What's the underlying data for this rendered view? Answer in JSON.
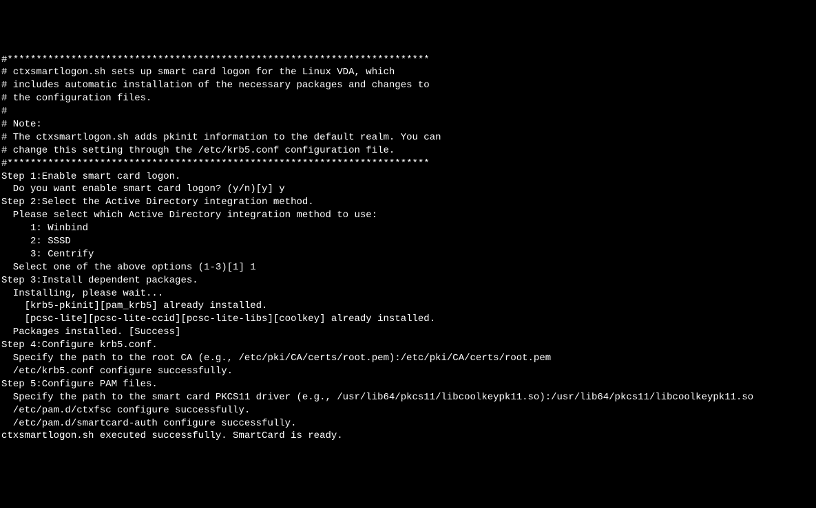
{
  "lines": {
    "l00": "#*************************************************************************",
    "l01": "# ctxsmartlogon.sh sets up smart card logon for the Linux VDA, which",
    "l02": "# includes automatic installation of the necessary packages and changes to",
    "l03": "# the configuration files.",
    "l04": "#",
    "l05": "# Note:",
    "l06": "# The ctxsmartlogon.sh adds pkinit information to the default realm. You can",
    "l07": "# change this setting through the /etc/krb5.conf configuration file.",
    "l08": "#*************************************************************************",
    "l09": "Step 1:Enable smart card logon.",
    "l10": "  Do you want enable smart card logon? (y/n)[y] y",
    "l11": "Step 2:Select the Active Directory integration method.",
    "l12": "  Please select which Active Directory integration method to use:",
    "l13": "     1: Winbind",
    "l14": "     2: SSSD",
    "l15": "     3: Centrify",
    "l16": "  Select one of the above options (1-3)[1] 1",
    "l17": "Step 3:Install dependent packages.",
    "l18": "  Installing, please wait...",
    "l19": "    [krb5-pkinit][pam_krb5] already installed.",
    "l20": "    [pcsc-lite][pcsc-lite-ccid][pcsc-lite-libs][coolkey] already installed.",
    "l21": "  Packages installed. [Success]",
    "l22": "Step 4:Configure krb5.conf.",
    "l23": "  Specify the path to the root CA (e.g., /etc/pki/CA/certs/root.pem):/etc/pki/CA/certs/root.pem",
    "l24": "  /etc/krb5.conf configure successfully.",
    "l25": "Step 5:Configure PAM files.",
    "l26": "  Specify the path to the smart card PKCS11 driver (e.g., /usr/lib64/pkcs11/libcoolkeypk11.so):/usr/lib64/pkcs11/libcoolkeypk11.so",
    "l27": "  /etc/pam.d/ctxfsc configure successfully.",
    "l28": "  /etc/pam.d/smartcard-auth configure successfully.",
    "l29": "ctxsmartlogon.sh executed successfully. SmartCard is ready."
  }
}
